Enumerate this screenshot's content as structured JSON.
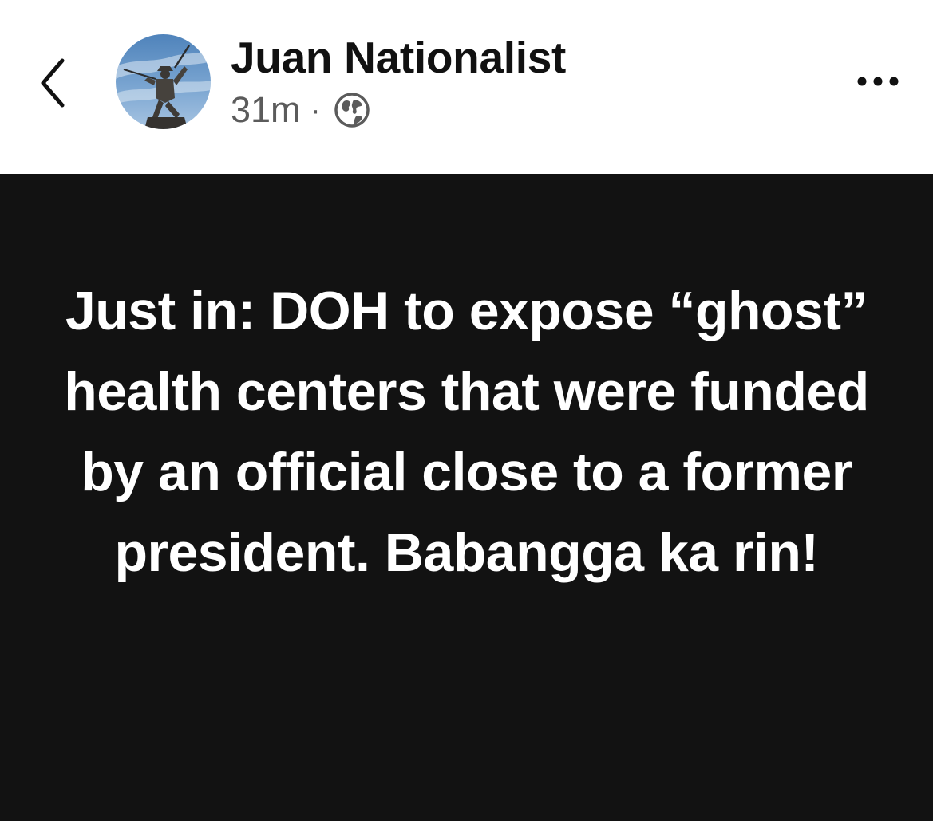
{
  "header": {
    "author_name": "Juan Nationalist",
    "timestamp": "31m",
    "separator": "·",
    "back_icon": "chevron-left-icon",
    "privacy_icon": "globe-icon",
    "more_icon": "more-horizontal-icon"
  },
  "post": {
    "text": "Just in: DOH to expose “ghost” health centers that were funded by an official close to a former president. Babangga ka rin!",
    "background_color": "#121212",
    "text_color": "#ffffff"
  }
}
